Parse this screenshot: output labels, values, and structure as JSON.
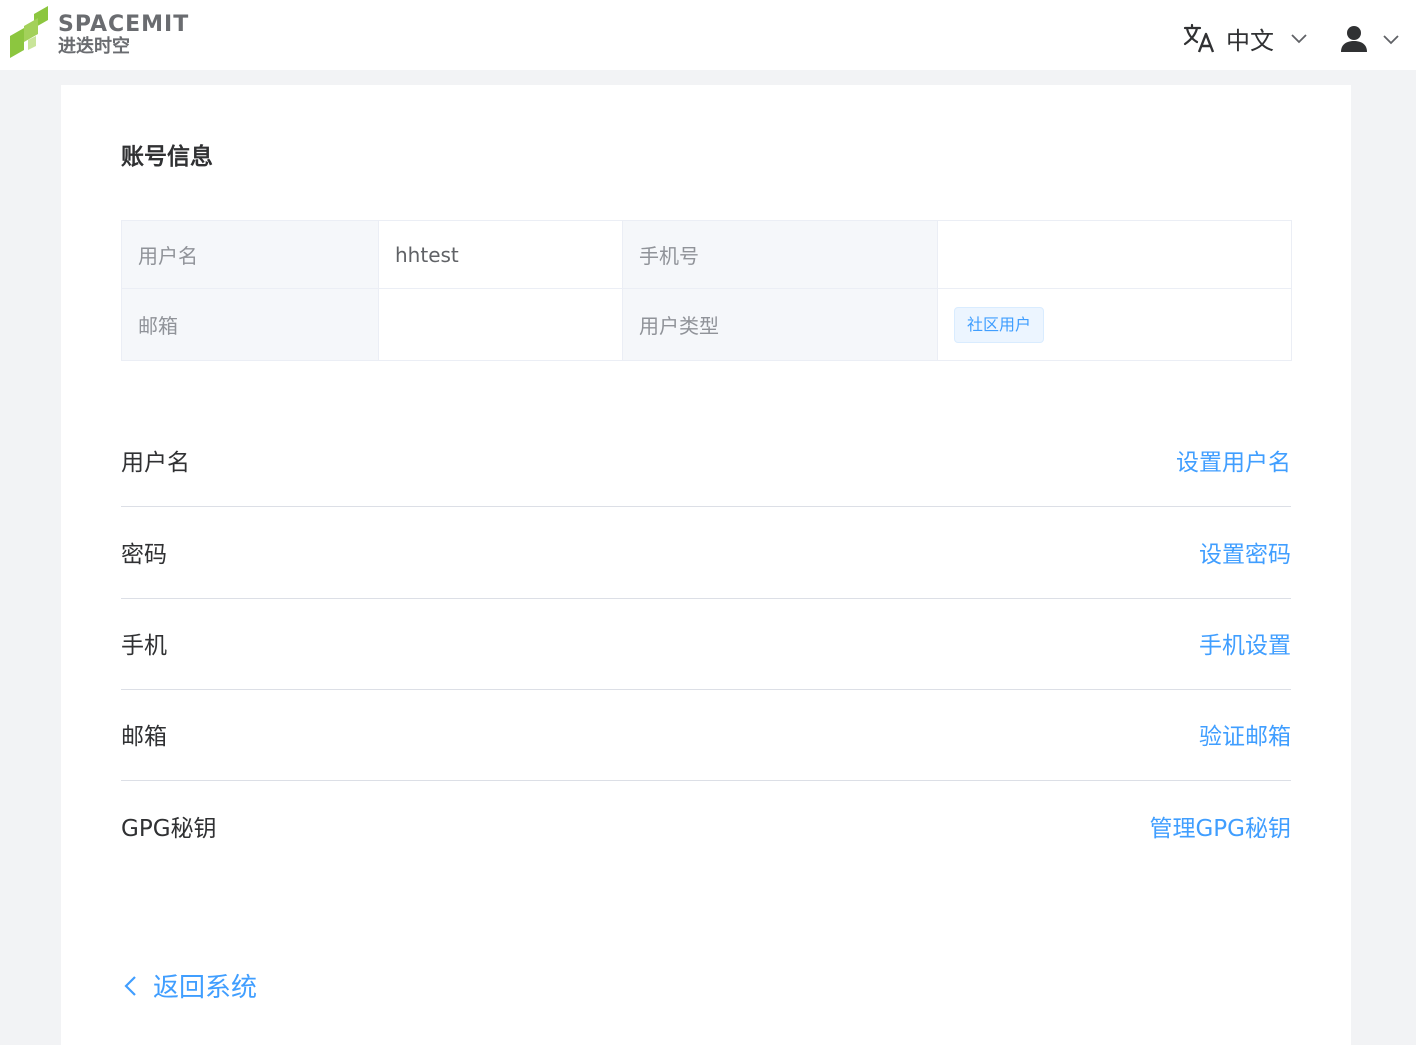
{
  "header": {
    "logo_en": "SPACEMIT",
    "logo_cn": "进迭时空",
    "language_label": "中文",
    "icons": {
      "language": "translate-icon",
      "language_caret": "chevron-down-icon",
      "user": "user-icon",
      "user_caret": "chevron-down-icon"
    }
  },
  "account": {
    "title": "账号信息",
    "username_label": "用户名",
    "username_value": "hhtest",
    "phone_label": "手机号",
    "phone_value": "",
    "email_label": "邮箱",
    "email_value": "",
    "user_type_label": "用户类型",
    "user_type_tag": "社区用户"
  },
  "settings": [
    {
      "label": "用户名",
      "action": "设置用户名"
    },
    {
      "label": "密码",
      "action": "设置密码"
    },
    {
      "label": "手机",
      "action": "手机设置"
    },
    {
      "label": "邮箱",
      "action": "验证邮箱"
    },
    {
      "label": "GPG秘钥",
      "action": "管理GPG秘钥"
    }
  ],
  "back": {
    "label": "返回系统",
    "icon": "chevron-left-icon"
  },
  "colors": {
    "accent": "#409eff",
    "logo_green": "#8cc63f",
    "page_bg": "#f2f3f5"
  }
}
